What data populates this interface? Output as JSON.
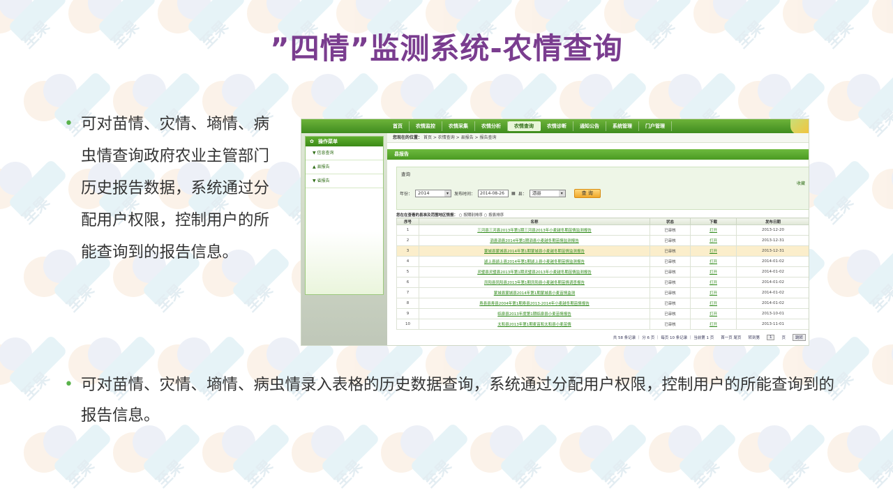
{
  "slide": {
    "title": "”四情”监测系统-农情查询",
    "bullet_left": "可对苗情、灾情、墒情、病虫情查询政府农业主管部门历史报告数据，系统通过分配用户权限，控制用户的所能查询到的报告信息。",
    "bullet_bottom": "可对苗情、灾情、墒情、病虫情录入表格的历史数据查询，系统通过分配用户权限，控制用户的所能查询到的报告信息。",
    "bullet_symbol": "•",
    "watermark_text": "至果"
  },
  "app": {
    "top_nav": [
      "首页",
      "农情监控",
      "农情采集",
      "农情分析",
      "农情查询",
      "农情诊断",
      "通知公告",
      "系统管理",
      "门户管理"
    ],
    "active_tab": "农情查询",
    "sidebar_title": "操作菜单",
    "sidebar_items": [
      "▼ 信息查询",
      "▲ 县报告",
      "▼ 省报告"
    ],
    "breadcrumb_label": "您现在的位置：",
    "breadcrumb": "首页 > 农情查询 > 县报告 > 报告查询",
    "report_bar": "县报告",
    "query_title": "查询",
    "favorite": "收藏",
    "year_label": "年份：",
    "year_value": "2014",
    "date_label": "发布时间：",
    "date_value": "2014-08-26",
    "county_label": "县：",
    "county_value": "泗县",
    "query_button": "查 询",
    "auth_text": "您在在查看的县准及范围地区情报：",
    "radio_1": "按期别排序",
    "radio_2": "按县排序",
    "table_headers": [
      "序号",
      "名称",
      "状态",
      "下载",
      "发布日期"
    ],
    "rows": [
      {
        "n": "1",
        "name": "三河县三河县2013年第1期三河县2013年小麦越冬期苗情监测报告",
        "status": "已审核",
        "dl": "打开",
        "date": "2013-12-20"
      },
      {
        "n": "2",
        "name": "泗县泗县2014年第1期泗县小麦越冬期苗情监测报告",
        "status": "已审核",
        "dl": "打开",
        "date": "2013-12-31"
      },
      {
        "n": "3",
        "name": "蒙城县蒙城县2014年第1期蒙城县小麦越冬期苗情监测报告",
        "status": "已审核",
        "dl": "打开",
        "date": "2013-12-31"
      },
      {
        "n": "4",
        "name": "颍上县颍上县2014年第1期颍上县小麦越冬期苗情监测报告",
        "status": "已审核",
        "dl": "打开",
        "date": "2014-01-02"
      },
      {
        "n": "5",
        "name": "灵璧县灵璧县2013年第1期灵璧县2013年小麦越冬期苗情监测报告",
        "status": "已审核",
        "dl": "打开",
        "date": "2014-01-02"
      },
      {
        "n": "6",
        "name": "凤阳县凤阳县2013年第1期凤阳县小麦越冬期苗情调查报告",
        "status": "已审核",
        "dl": "打开",
        "date": "2014-01-02"
      },
      {
        "n": "7",
        "name": "蒙城县蒙城县2014年第1期蒙城县小麦苗情监测",
        "status": "已审核",
        "dl": "打开",
        "date": "2014-01-02"
      },
      {
        "n": "8",
        "name": "寿县县寿县2004年第1期寿县2013-2014年小麦越冬期苗情报告",
        "status": "已审核",
        "dl": "打开",
        "date": "2014-01-02"
      },
      {
        "n": "9",
        "name": "临泉县2013年度第1期临泉县小麦苗情报告",
        "status": "已审核",
        "dl": "打开",
        "date": "2013-10-01"
      },
      {
        "n": "10",
        "name": "太和县2013年第1期麦苗和太和县小麦苗情",
        "status": "已审核",
        "dl": "打开",
        "date": "2013-11-01"
      }
    ],
    "pager_info": "共 58 条记录 ｜ 分 6 页 ｜ 每页 10 条记录 ｜ 当前第 1 页",
    "pager_nav": "首一页 尾页",
    "pager_jump_label": "转到第",
    "pager_jump_value": "1",
    "pager_page": "页",
    "pager_go": "跳转"
  },
  "colors": {
    "title": "#7a3d8f",
    "bullet": "#59b24a",
    "green": "#4a9a22"
  }
}
